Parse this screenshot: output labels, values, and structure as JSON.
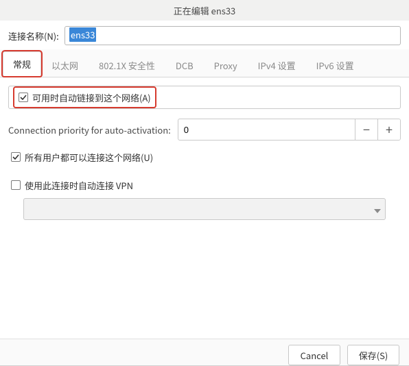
{
  "window": {
    "title": "正在编辑 ens33"
  },
  "name_row": {
    "label": "连接名称(N):",
    "value": "ens33"
  },
  "tabs": [
    {
      "label": "常规",
      "active": true,
      "highlighted": true
    },
    {
      "label": "以太网"
    },
    {
      "label": "802.1X 安全性"
    },
    {
      "label": "DCB"
    },
    {
      "label": "Proxy"
    },
    {
      "label": "IPv4 设置"
    },
    {
      "label": "IPv6 设置"
    }
  ],
  "general": {
    "auto_connect": {
      "label": "可用时自动链接到这个网络(A)",
      "checked": true,
      "highlighted": true
    },
    "priority": {
      "label": "Connection priority for auto-activation:",
      "value": "0",
      "minus": "−",
      "plus": "+"
    },
    "all_users": {
      "label": "所有用户都可以连接这个网络(U)",
      "checked": true
    },
    "auto_vpn": {
      "label": "使用此连接时自动连接 VPN",
      "checked": false
    }
  },
  "actions": {
    "cancel": "Cancel",
    "save": "保存(S)"
  }
}
